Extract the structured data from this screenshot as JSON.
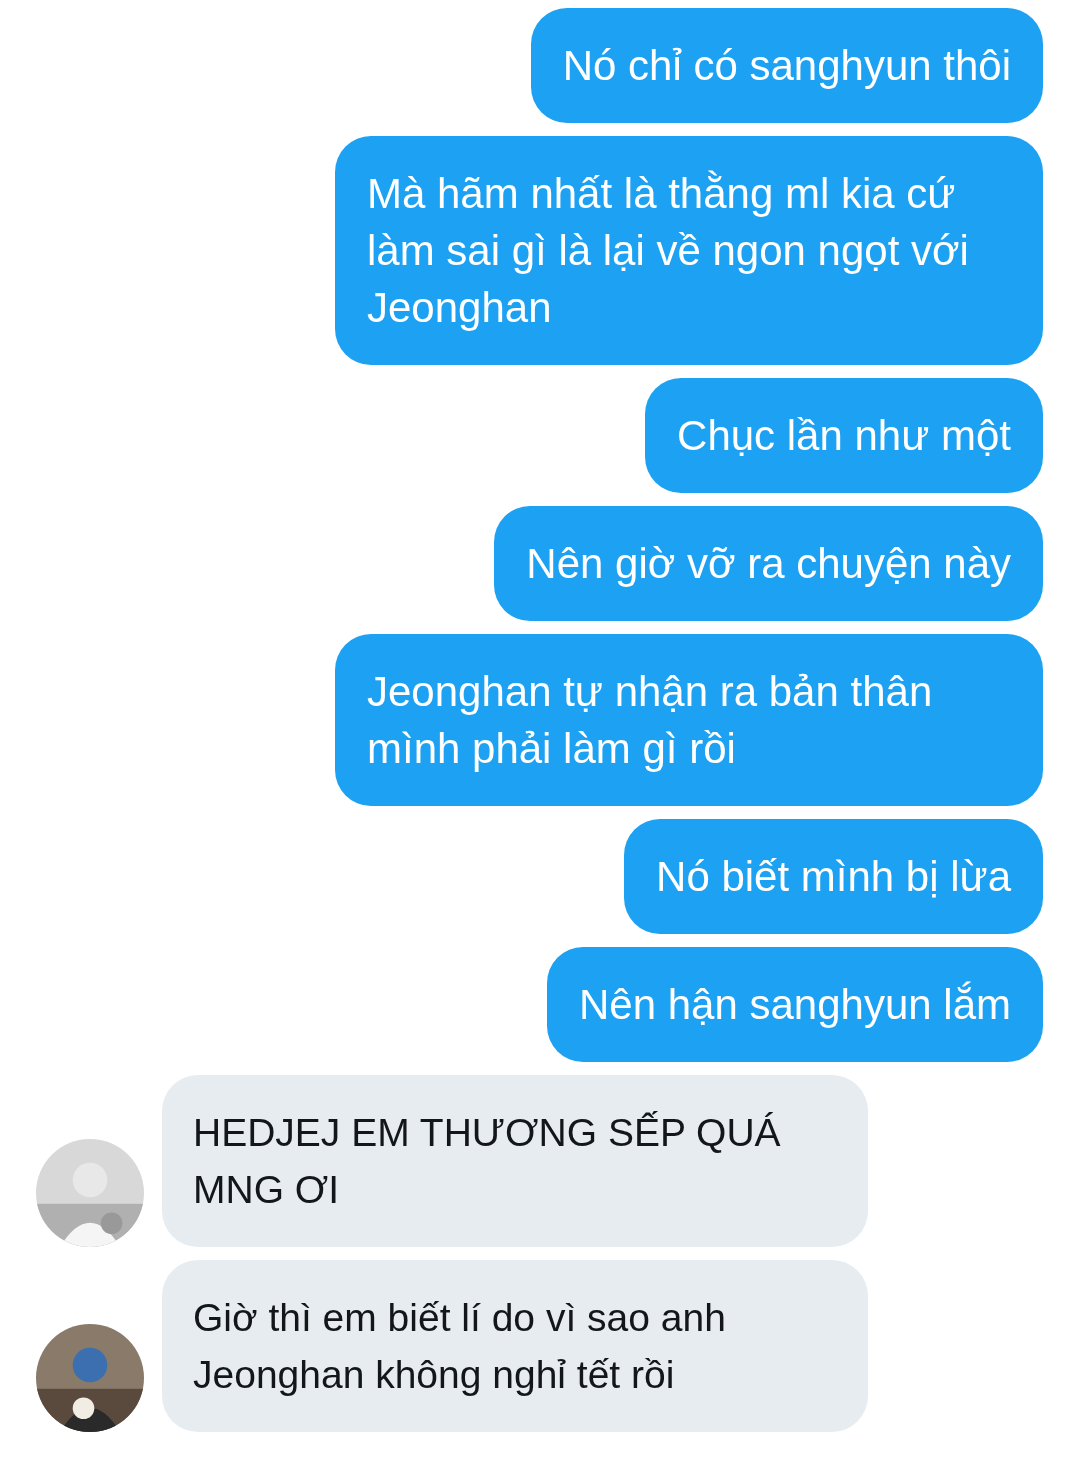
{
  "messages": [
    {
      "kind": "outgoing",
      "text": "Nó chỉ có sanghyun thôi"
    },
    {
      "kind": "outgoing",
      "text": "Mà hãm nhất là thằng ml kia cứ làm sai gì là lại về ngon ngọt với Jeonghan"
    },
    {
      "kind": "outgoing",
      "text": "Chục lần như một"
    },
    {
      "kind": "outgoing",
      "text": "Nên giờ vỡ ra chuyện này"
    },
    {
      "kind": "outgoing",
      "text": "Jeonghan tự nhận ra bản thân mình phải làm gì rồi"
    },
    {
      "kind": "outgoing",
      "text": "Nó biết mình bị lừa"
    },
    {
      "kind": "outgoing",
      "text": "Nên hận sanghyun lắm"
    },
    {
      "kind": "incoming",
      "text": "HEDJEJ EM THƯƠNG SẾP QUÁ MNG ƠI"
    },
    {
      "kind": "incoming",
      "text": "Giờ thì em biết lí do vì sao anh Jeonghan không nghỉ tết rồi"
    }
  ]
}
